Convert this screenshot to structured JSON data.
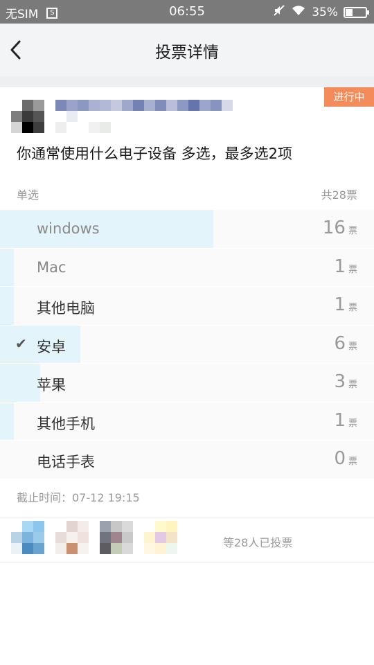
{
  "status_bar": {
    "carrier": "无SIM",
    "sim_icon_text": "S",
    "time": "06:55",
    "battery": "35%",
    "battery_level": 0.35
  },
  "nav": {
    "title": "投票详情",
    "back_icon": "chevron-left-icon"
  },
  "poll": {
    "status_badge": "进行中",
    "question": "你通常使用什么电子设备 多选，最多选2项",
    "mode_label": "单选",
    "total_votes": "共28票",
    "vote_unit": "票",
    "total": 28,
    "options": [
      {
        "label": "windows",
        "count": "16",
        "share": 0.571,
        "selected": false
      },
      {
        "label": "Mac",
        "count": "1",
        "share": 0.036,
        "selected": false
      },
      {
        "label": "其他电脑",
        "count": "1",
        "share": 0.036,
        "selected": false
      },
      {
        "label": "安卓",
        "count": "6",
        "share": 0.214,
        "selected": true
      },
      {
        "label": "苹果",
        "count": "3",
        "share": 0.107,
        "selected": false
      },
      {
        "label": "其他手机",
        "count": "1",
        "share": 0.036,
        "selected": false
      },
      {
        "label": "电话手表",
        "count": "0",
        "share": 0,
        "selected": false
      }
    ],
    "deadline": "截止时间：07-12 19:15",
    "voters_text": "等28人已投票"
  },
  "colors": {
    "badge": "#f48b5b",
    "vote_bar": "#e3f5fb"
  }
}
